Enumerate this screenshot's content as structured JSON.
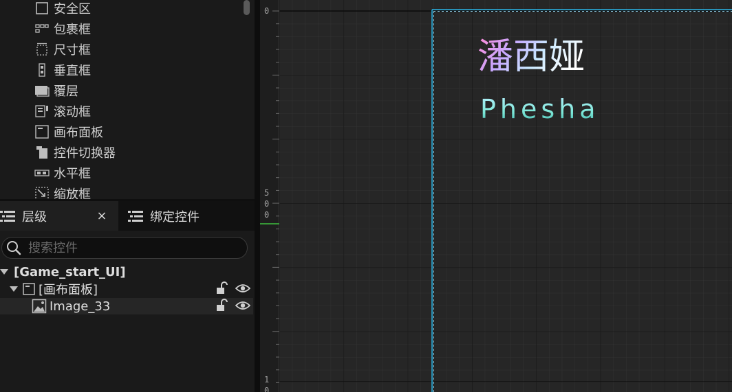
{
  "palette": {
    "items": [
      {
        "label": "安全区",
        "icon": "safe-zone-icon"
      },
      {
        "label": "包裹框",
        "icon": "wrap-box-icon"
      },
      {
        "label": "尺寸框",
        "icon": "size-box-icon"
      },
      {
        "label": "垂直框",
        "icon": "vertical-box-icon"
      },
      {
        "label": "覆层",
        "icon": "overlay-icon"
      },
      {
        "label": "滚动框",
        "icon": "scroll-box-icon"
      },
      {
        "label": "画布面板",
        "icon": "canvas-panel-icon"
      },
      {
        "label": "控件切换器",
        "icon": "widget-switcher-icon"
      },
      {
        "label": "水平框",
        "icon": "horizontal-box-icon"
      },
      {
        "label": "缩放框",
        "icon": "scale-box-icon"
      }
    ]
  },
  "tabs": {
    "hierarchy": "层级",
    "close": "×",
    "bindings": "绑定控件"
  },
  "search": {
    "placeholder": "搜索控件"
  },
  "tree": {
    "root": "[Game_start_UI]",
    "canvas": "[画布面板]",
    "image": "Image_33"
  },
  "ruler": {
    "top": "0",
    "mid": [
      "5",
      "0",
      "0"
    ],
    "bottom": [
      "1",
      "0"
    ]
  },
  "canvas_content": {
    "title_cn": "潘西娅",
    "title_en": "Phesha"
  },
  "colors": {
    "selection_outline": "#29b6e8",
    "ruler_marker": "#3fbf3f",
    "gradient_pink": "#ff8ad8",
    "gradient_cyan": "#7ee8d8"
  }
}
